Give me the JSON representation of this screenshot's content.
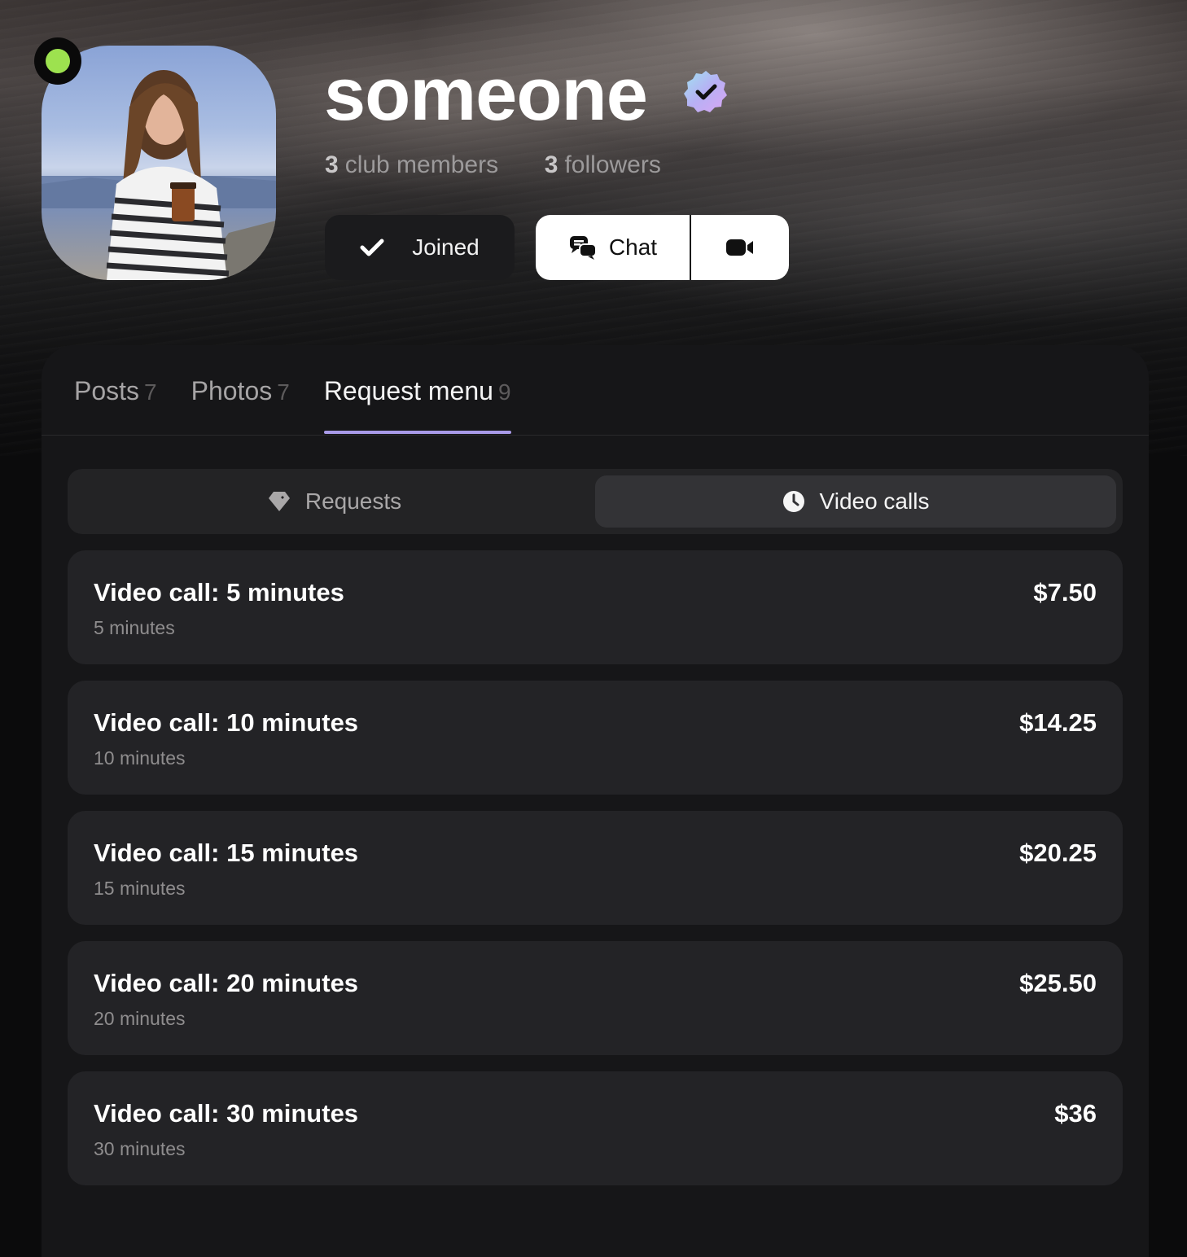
{
  "profile": {
    "username": "someone",
    "club_members_count": "3",
    "club_members_label": "club members",
    "followers_count": "3",
    "followers_label": "followers",
    "online": true,
    "verified": true
  },
  "actions": {
    "joined_label": "Joined",
    "chat_label": "Chat"
  },
  "tabs": [
    {
      "label": "Posts",
      "count": "7",
      "active": false
    },
    {
      "label": "Photos",
      "count": "7",
      "active": false
    },
    {
      "label": "Request menu",
      "count": "9",
      "active": true
    }
  ],
  "segments": [
    {
      "label": "Requests",
      "icon": "diamond-icon",
      "active": false
    },
    {
      "label": "Video calls",
      "icon": "clock-icon",
      "active": true
    }
  ],
  "items": [
    {
      "title": "Video call: 5 minutes",
      "subtitle": "5 minutes",
      "price": "$7.50"
    },
    {
      "title": "Video call: 10 minutes",
      "subtitle": "10 minutes",
      "price": "$14.25"
    },
    {
      "title": "Video call: 15 minutes",
      "subtitle": "15 minutes",
      "price": "$20.25"
    },
    {
      "title": "Video call: 20 minutes",
      "subtitle": "20 minutes",
      "price": "$25.50"
    },
    {
      "title": "Video call: 30 minutes",
      "subtitle": "30 minutes",
      "price": "$36"
    }
  ],
  "colors": {
    "accent": "#a89ae8",
    "online": "#9de24f",
    "background": "#0b0b0c",
    "card": "#232326"
  }
}
